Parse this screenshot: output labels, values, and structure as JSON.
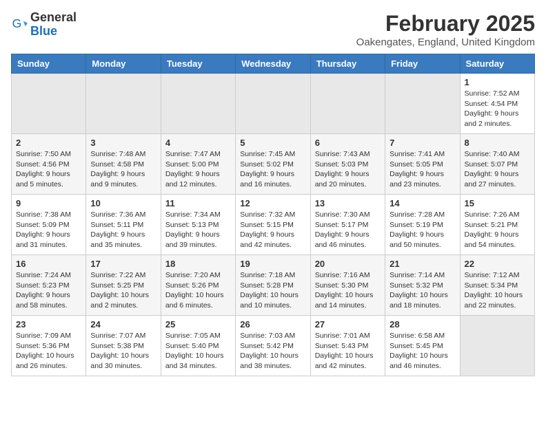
{
  "header": {
    "logo_general": "General",
    "logo_blue": "Blue",
    "month_title": "February 2025",
    "location": "Oakengates, England, United Kingdom"
  },
  "weekdays": [
    "Sunday",
    "Monday",
    "Tuesday",
    "Wednesday",
    "Thursday",
    "Friday",
    "Saturday"
  ],
  "weeks": [
    [
      {
        "day": "",
        "info": ""
      },
      {
        "day": "",
        "info": ""
      },
      {
        "day": "",
        "info": ""
      },
      {
        "day": "",
        "info": ""
      },
      {
        "day": "",
        "info": ""
      },
      {
        "day": "",
        "info": ""
      },
      {
        "day": "1",
        "info": "Sunrise: 7:52 AM\nSunset: 4:54 PM\nDaylight: 9 hours and 2 minutes."
      }
    ],
    [
      {
        "day": "2",
        "info": "Sunrise: 7:50 AM\nSunset: 4:56 PM\nDaylight: 9 hours and 5 minutes."
      },
      {
        "day": "3",
        "info": "Sunrise: 7:48 AM\nSunset: 4:58 PM\nDaylight: 9 hours and 9 minutes."
      },
      {
        "day": "4",
        "info": "Sunrise: 7:47 AM\nSunset: 5:00 PM\nDaylight: 9 hours and 12 minutes."
      },
      {
        "day": "5",
        "info": "Sunrise: 7:45 AM\nSunset: 5:02 PM\nDaylight: 9 hours and 16 minutes."
      },
      {
        "day": "6",
        "info": "Sunrise: 7:43 AM\nSunset: 5:03 PM\nDaylight: 9 hours and 20 minutes."
      },
      {
        "day": "7",
        "info": "Sunrise: 7:41 AM\nSunset: 5:05 PM\nDaylight: 9 hours and 23 minutes."
      },
      {
        "day": "8",
        "info": "Sunrise: 7:40 AM\nSunset: 5:07 PM\nDaylight: 9 hours and 27 minutes."
      }
    ],
    [
      {
        "day": "9",
        "info": "Sunrise: 7:38 AM\nSunset: 5:09 PM\nDaylight: 9 hours and 31 minutes."
      },
      {
        "day": "10",
        "info": "Sunrise: 7:36 AM\nSunset: 5:11 PM\nDaylight: 9 hours and 35 minutes."
      },
      {
        "day": "11",
        "info": "Sunrise: 7:34 AM\nSunset: 5:13 PM\nDaylight: 9 hours and 39 minutes."
      },
      {
        "day": "12",
        "info": "Sunrise: 7:32 AM\nSunset: 5:15 PM\nDaylight: 9 hours and 42 minutes."
      },
      {
        "day": "13",
        "info": "Sunrise: 7:30 AM\nSunset: 5:17 PM\nDaylight: 9 hours and 46 minutes."
      },
      {
        "day": "14",
        "info": "Sunrise: 7:28 AM\nSunset: 5:19 PM\nDaylight: 9 hours and 50 minutes."
      },
      {
        "day": "15",
        "info": "Sunrise: 7:26 AM\nSunset: 5:21 PM\nDaylight: 9 hours and 54 minutes."
      }
    ],
    [
      {
        "day": "16",
        "info": "Sunrise: 7:24 AM\nSunset: 5:23 PM\nDaylight: 9 hours and 58 minutes."
      },
      {
        "day": "17",
        "info": "Sunrise: 7:22 AM\nSunset: 5:25 PM\nDaylight: 10 hours and 2 minutes."
      },
      {
        "day": "18",
        "info": "Sunrise: 7:20 AM\nSunset: 5:26 PM\nDaylight: 10 hours and 6 minutes."
      },
      {
        "day": "19",
        "info": "Sunrise: 7:18 AM\nSunset: 5:28 PM\nDaylight: 10 hours and 10 minutes."
      },
      {
        "day": "20",
        "info": "Sunrise: 7:16 AM\nSunset: 5:30 PM\nDaylight: 10 hours and 14 minutes."
      },
      {
        "day": "21",
        "info": "Sunrise: 7:14 AM\nSunset: 5:32 PM\nDaylight: 10 hours and 18 minutes."
      },
      {
        "day": "22",
        "info": "Sunrise: 7:12 AM\nSunset: 5:34 PM\nDaylight: 10 hours and 22 minutes."
      }
    ],
    [
      {
        "day": "23",
        "info": "Sunrise: 7:09 AM\nSunset: 5:36 PM\nDaylight: 10 hours and 26 minutes."
      },
      {
        "day": "24",
        "info": "Sunrise: 7:07 AM\nSunset: 5:38 PM\nDaylight: 10 hours and 30 minutes."
      },
      {
        "day": "25",
        "info": "Sunrise: 7:05 AM\nSunset: 5:40 PM\nDaylight: 10 hours and 34 minutes."
      },
      {
        "day": "26",
        "info": "Sunrise: 7:03 AM\nSunset: 5:42 PM\nDaylight: 10 hours and 38 minutes."
      },
      {
        "day": "27",
        "info": "Sunrise: 7:01 AM\nSunset: 5:43 PM\nDaylight: 10 hours and 42 minutes."
      },
      {
        "day": "28",
        "info": "Sunrise: 6:58 AM\nSunset: 5:45 PM\nDaylight: 10 hours and 46 minutes."
      },
      {
        "day": "",
        "info": ""
      }
    ]
  ]
}
